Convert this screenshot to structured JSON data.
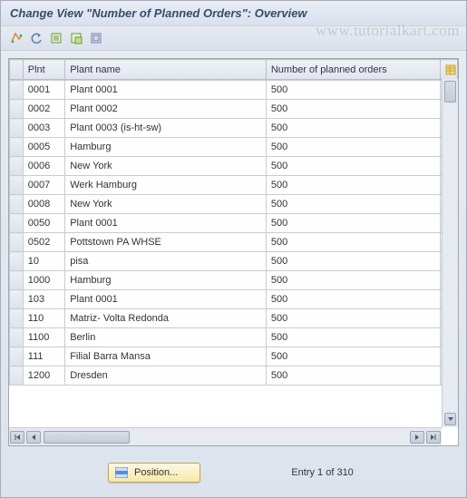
{
  "title": "Change View \"Number of Planned Orders\": Overview",
  "watermark": "www.tutorialkart.com",
  "toolbar": {
    "btn1": "other-view",
    "btn2": "undo",
    "btn3": "new-entries",
    "btn4": "copy-as",
    "btn5": "select-all"
  },
  "columns": {
    "plnt": "Plnt",
    "plant_name": "Plant name",
    "num_orders": "Number of planned orders"
  },
  "rows": [
    {
      "plnt": "0001",
      "name": "Plant 0001",
      "num": "500"
    },
    {
      "plnt": "0002",
      "name": "Plant 0002",
      "num": "500"
    },
    {
      "plnt": "0003",
      "name": "Plant 0003 (is-ht-sw)",
      "num": "500"
    },
    {
      "plnt": "0005",
      "name": "Hamburg",
      "num": "500"
    },
    {
      "plnt": "0006",
      "name": "New York",
      "num": "500"
    },
    {
      "plnt": "0007",
      "name": "Werk Hamburg",
      "num": "500"
    },
    {
      "plnt": "0008",
      "name": "New York",
      "num": "500"
    },
    {
      "plnt": "0050",
      "name": "Plant 0001",
      "num": "500"
    },
    {
      "plnt": "0502",
      "name": "Pottstown PA WHSE",
      "num": "500"
    },
    {
      "plnt": "10",
      "name": "pisa",
      "num": "500"
    },
    {
      "plnt": "1000",
      "name": "Hamburg",
      "num": "500"
    },
    {
      "plnt": "103",
      "name": "Plant 0001",
      "num": "500"
    },
    {
      "plnt": "110",
      "name": "Matriz- Volta Redonda",
      "num": "500"
    },
    {
      "plnt": "1100",
      "name": "Berlin",
      "num": "500"
    },
    {
      "plnt": "111",
      "name": "Filial Barra Mansa",
      "num": "500"
    },
    {
      "plnt": "1200",
      "name": "Dresden",
      "num": "500"
    }
  ],
  "footer": {
    "position_label": "Position...",
    "entry_text": "Entry 1 of 310"
  }
}
